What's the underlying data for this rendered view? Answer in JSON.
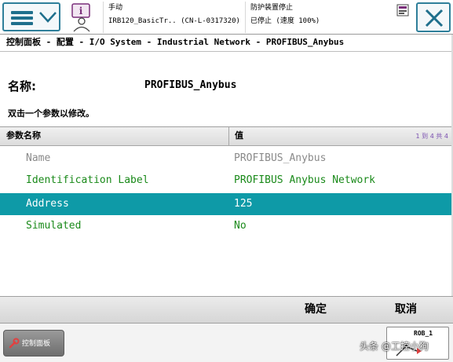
{
  "header": {
    "status_mode": "手动",
    "status_system": "IRB120_BasicTr.. (CN-L-0317320)",
    "status_safety": "防护装置停止",
    "status_state": "已停止 (速度 100%)"
  },
  "breadcrumb": "控制面板 - 配置 - I/O System - Industrial Network - PROFIBUS_Anybus",
  "name_label": "名称:",
  "name_value": "PROFIBUS_Anybus",
  "hint": "双击一个参数以修改。",
  "table": {
    "col_name": "参数名称",
    "col_value": "值",
    "pager": "1 到 4 共 4",
    "rows": [
      {
        "name": "Name",
        "value": "PROFIBUS_Anybus"
      },
      {
        "name": "Identification Label",
        "value": "PROFIBUS Anybus Network"
      },
      {
        "name": "Address",
        "value": "125"
      },
      {
        "name": "Simulated",
        "value": "No"
      }
    ]
  },
  "actions": {
    "ok": "确定",
    "cancel": "取消"
  },
  "taskbar": {
    "item_label": "控制面板",
    "robot_label": "ROB_1",
    "watermark": "头条 @工控小狗"
  },
  "colors": {
    "selected_row": "#0e9aa7",
    "green_text": "#1a8a1a",
    "accent": "#1f6f8c"
  }
}
